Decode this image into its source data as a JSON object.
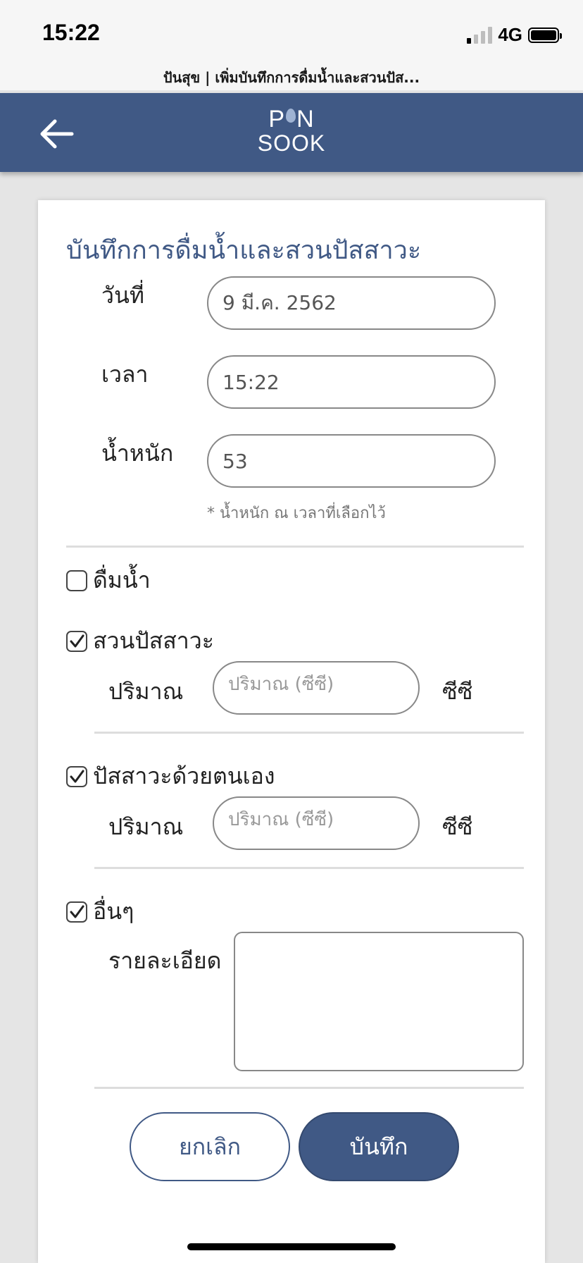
{
  "status_bar": {
    "time": "15:22",
    "network": "4G"
  },
  "page_url": "ปันสุข | เพิ่มบันทึกการดื่มน้ำและสวนปัส...",
  "header": {
    "logo_line1_left": "P",
    "logo_line1_right": "N",
    "logo_line2": "SOOK"
  },
  "form": {
    "title": "บันทึกการดื่มน้ำและสวนปัสสาวะ",
    "date": {
      "label": "วันที่",
      "value": "9 มี.ค. 2562"
    },
    "time": {
      "label": "เวลา",
      "value": "15:22"
    },
    "weight": {
      "label": "น้ำหนัก",
      "value": "53",
      "note": "* น้ำหนัก ณ เวลาที่เลือกไว้"
    },
    "drink_water": {
      "label": "ดื่มน้ำ",
      "checked": false
    },
    "catheter": {
      "label": "สวนปัสสาวะ",
      "checked": true,
      "amount_label": "ปริมาณ",
      "placeholder": "ปริมาณ (ซีซี)",
      "unit": "ซีซี"
    },
    "self_urinate": {
      "label": "ปัสสาวะด้วยตนเอง",
      "checked": true,
      "amount_label": "ปริมาณ",
      "placeholder": "ปริมาณ (ซีซี)",
      "unit": "ซีซี"
    },
    "other": {
      "label": "อื่นๆ",
      "checked": true,
      "detail_label": "รายละเอียด"
    },
    "cancel_label": "ยกเลิก",
    "save_label": "บันทึก"
  },
  "colors": {
    "primary": "#405985",
    "background": "#e5e5e5"
  }
}
